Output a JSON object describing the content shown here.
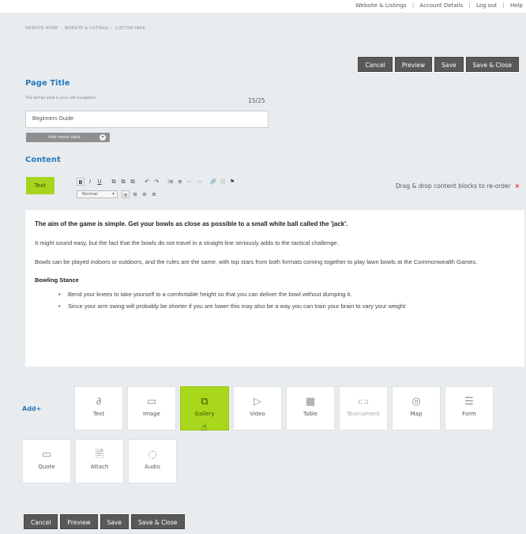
{
  "topnav": {
    "links": [
      "Website & Listings",
      "Account Details",
      "Log out",
      "Help"
    ],
    "separator": "|"
  },
  "breadcrumb": {
    "items": [
      "WEBSITE HOME",
      "WEBSITE & LISTINGS",
      "CUSTOM PAGE"
    ],
    "separator": "›"
  },
  "actions": {
    "cancel": "Cancel",
    "preview": "Preview",
    "save": "Save",
    "save_close": "Save & Close"
  },
  "page_title_section": {
    "heading": "Page Title",
    "helper": "This will be used in your site navigation",
    "counter": "15/25",
    "value": "Beginners Guide",
    "meta_button": "Add meta data"
  },
  "content_section": {
    "heading": "Content",
    "block_tag": "Text",
    "drag_hint": "Drag & drop content blocks to re-order",
    "remove_icon": "×",
    "format_select": "Normal",
    "toolbar_row1": [
      "B",
      "I",
      "U",
      "⧉",
      "⧉",
      "⧉",
      "↶",
      "↷",
      "⁝≡",
      "≡",
      "⇤",
      "⇥",
      "🔗",
      "⛓",
      "⚑"
    ],
    "toolbar_row2": [
      "≡",
      "≡",
      "≡",
      "≡"
    ]
  },
  "article": {
    "lead": "The aim of the game is simple. Get your bowls as close as possible to a small white ball called the 'jack'.",
    "p1": "It might sound easy, but the fact that the bowls do not travel in a straight line seriously adds to the tactical challenge.",
    "p2": "Bowls can be played indoors or outdoors, and the rules are the same, with top stars from both formats coming together to play lawn bowls at the Commonwealth Games.",
    "subheading": "Bowling Stance",
    "bullets": [
      "Bend your knees to take yourself to a comfortable height so that you can deliver the bowl without dumping it.",
      "Since your arm swing will probably be shorter if you are lower this may also be a way you can train your brain to vary your weight"
    ]
  },
  "add_blocks": {
    "label": "Add+",
    "blocks": [
      {
        "label": "Text",
        "icon": "text-icon"
      },
      {
        "label": "Image",
        "icon": "image-icon"
      },
      {
        "label": "Gallery",
        "icon": "gallery-icon",
        "active": true
      },
      {
        "label": "Video",
        "icon": "video-icon"
      },
      {
        "label": "Table",
        "icon": "table-icon"
      },
      {
        "label": "Tournament",
        "icon": "tournament-icon"
      },
      {
        "label": "Map",
        "icon": "map-pin-icon"
      },
      {
        "label": "Form",
        "icon": "form-icon"
      },
      {
        "label": "Quote",
        "icon": "quote-icon"
      },
      {
        "label": "Attach",
        "icon": "attach-icon"
      },
      {
        "label": "Audio",
        "icon": "audio-icon"
      }
    ]
  },
  "colors": {
    "accent_blue": "#2a7ab8",
    "lime": "#a7d51e",
    "button_dark": "#595959",
    "remove_red": "#dd2222"
  }
}
